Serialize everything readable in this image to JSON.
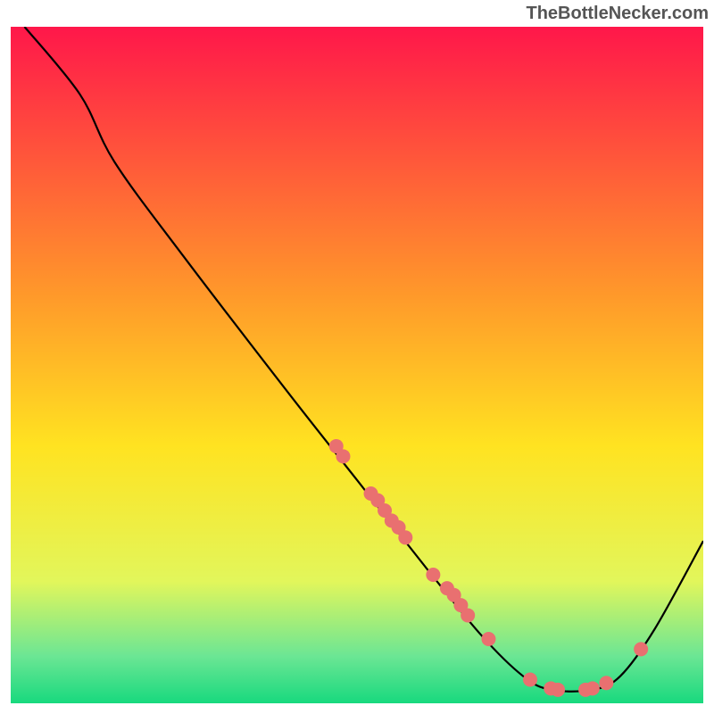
{
  "attribution": "TheBottleNecker.com",
  "chart_data": {
    "type": "line",
    "title": "",
    "xlabel": "",
    "ylabel": "",
    "xlim": [
      0,
      100
    ],
    "ylim": [
      0,
      100
    ],
    "grid": false,
    "background_gradient": {
      "stops": [
        {
          "offset": 0,
          "color": "#ff174a"
        },
        {
          "offset": 40,
          "color": "#ff9a2a"
        },
        {
          "offset": 62,
          "color": "#ffe321"
        },
        {
          "offset": 82,
          "color": "#e2f65b"
        },
        {
          "offset": 93,
          "color": "#6ce694"
        },
        {
          "offset": 100,
          "color": "#18d97e"
        }
      ]
    },
    "curve": [
      {
        "x": 2,
        "y": 100
      },
      {
        "x": 10,
        "y": 90
      },
      {
        "x": 15,
        "y": 80
      },
      {
        "x": 25,
        "y": 66
      },
      {
        "x": 40,
        "y": 46
      },
      {
        "x": 50,
        "y": 33
      },
      {
        "x": 60,
        "y": 20
      },
      {
        "x": 68,
        "y": 10
      },
      {
        "x": 74,
        "y": 4
      },
      {
        "x": 78,
        "y": 2
      },
      {
        "x": 84,
        "y": 2
      },
      {
        "x": 88,
        "y": 4
      },
      {
        "x": 93,
        "y": 11
      },
      {
        "x": 100,
        "y": 24
      }
    ],
    "data_points": [
      {
        "x": 47,
        "y": 38
      },
      {
        "x": 48,
        "y": 36.5
      },
      {
        "x": 52,
        "y": 31
      },
      {
        "x": 53,
        "y": 30
      },
      {
        "x": 54,
        "y": 28.5
      },
      {
        "x": 55,
        "y": 27
      },
      {
        "x": 56,
        "y": 26
      },
      {
        "x": 57,
        "y": 24.5
      },
      {
        "x": 61,
        "y": 19
      },
      {
        "x": 63,
        "y": 17
      },
      {
        "x": 64,
        "y": 16
      },
      {
        "x": 65,
        "y": 14.5
      },
      {
        "x": 66,
        "y": 13
      },
      {
        "x": 69,
        "y": 9.5
      },
      {
        "x": 75,
        "y": 3.5
      },
      {
        "x": 78,
        "y": 2.2
      },
      {
        "x": 79,
        "y": 2
      },
      {
        "x": 83,
        "y": 2
      },
      {
        "x": 84,
        "y": 2.2
      },
      {
        "x": 86,
        "y": 3
      },
      {
        "x": 91,
        "y": 8
      }
    ],
    "point_style": {
      "fill": "#e97070",
      "radius": 8
    }
  }
}
